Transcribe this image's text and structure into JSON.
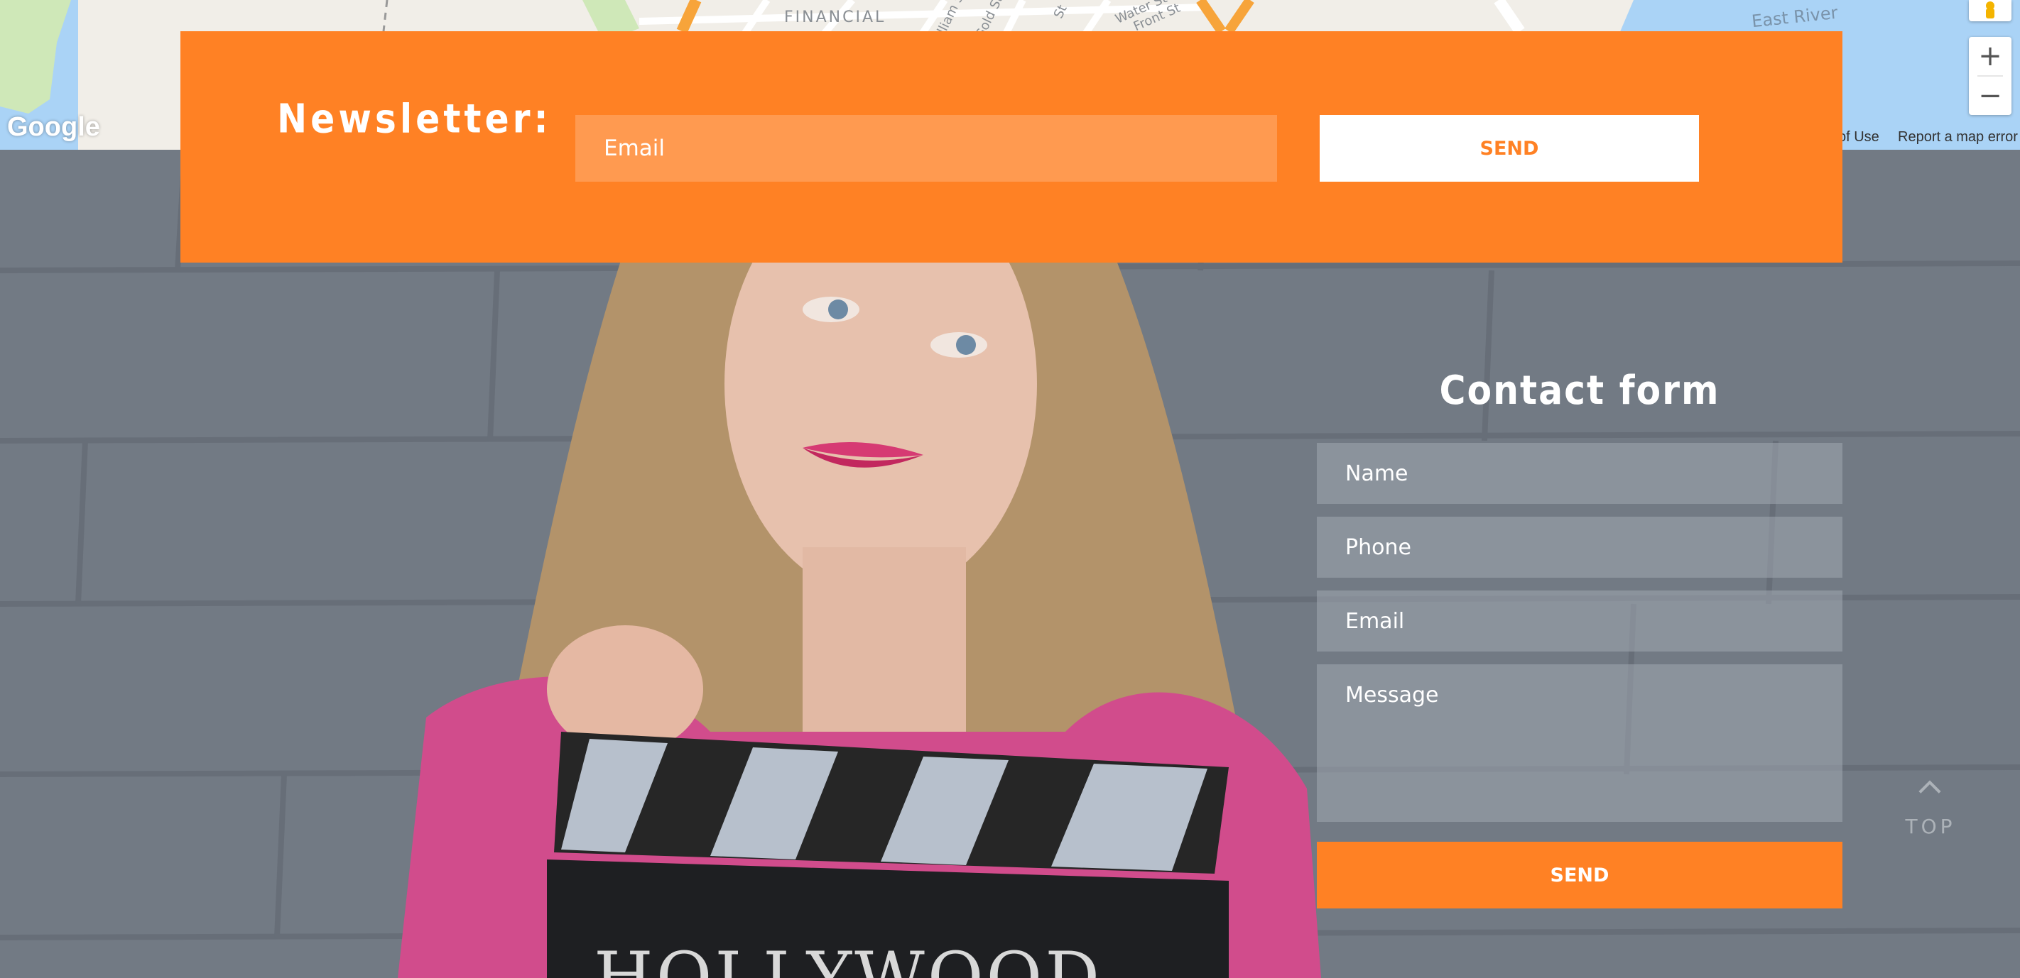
{
  "map": {
    "labels": {
      "financial": "FINANCIAL",
      "street_william": "William St",
      "street_gold": "Gold St",
      "street_st": "St",
      "street_water": "Water St",
      "street_front": "Front St",
      "river": "East River"
    },
    "google_logo": "Google",
    "terms": "of Use",
    "report": "Report a map error",
    "zoom_in": "+",
    "zoom_out": "−",
    "colors": {
      "land": "#f1eee8",
      "water": "#aad3f6",
      "park": "#cfe8b8",
      "highway": "#f7a43a"
    }
  },
  "newsletter": {
    "title": "Newsletter:",
    "email_placeholder": "Email",
    "send_label": "SEND"
  },
  "contact": {
    "title": "Contact form",
    "name_placeholder": "Name",
    "phone_placeholder": "Phone",
    "email_placeholder": "Email",
    "message_placeholder": "Message",
    "send_label": "SEND"
  },
  "hero": {
    "clapboard_text": "HOLLYWOOD"
  },
  "scroll_top": {
    "label": "TOP",
    "icon": "chevron-up-icon"
  },
  "colors": {
    "accent": "#ff8124",
    "wall": "#727a84",
    "field_bg": "rgba(160,168,176,0.55)"
  }
}
